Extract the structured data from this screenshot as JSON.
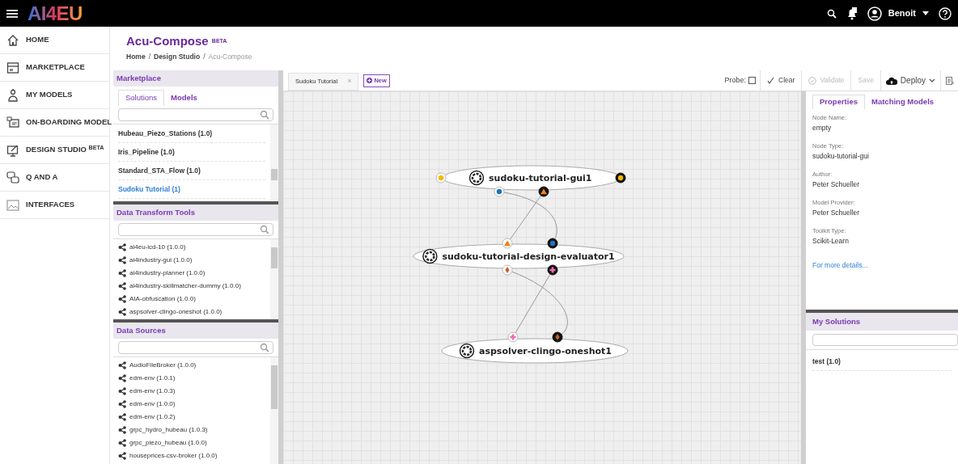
{
  "topbar": {
    "logo": "AI4EU",
    "user": "Benoit"
  },
  "sidebar": {
    "items": [
      {
        "label": "HOME"
      },
      {
        "label": "MARKETPLACE"
      },
      {
        "label": "MY MODELS"
      },
      {
        "label": "ON-BOARDING MODEL"
      },
      {
        "label": "DESIGN STUDIO $^{BETA}$"
      },
      {
        "label": "Q AND A"
      },
      {
        "label": "INTERFACES"
      }
    ]
  },
  "header": {
    "title": "Acu-Compose $^{BETA}$",
    "breadcrumb": [
      {
        "label": "Home",
        "current": false
      },
      {
        "label": "Design Studio",
        "current": false
      },
      {
        "label": "Acu-Compose",
        "current": true
      }
    ],
    "separator": "/"
  },
  "marketplace": {
    "title": "Marketplace",
    "tabs": [
      {
        "label": "Solutions",
        "selected": true
      },
      {
        "label": "Models",
        "selected": false
      }
    ],
    "items": [
      {
        "label": "Hubeau_Piezo_Stations (1.0)",
        "selected": false
      },
      {
        "label": "Iris_Pipeline (1.0)",
        "selected": false
      },
      {
        "label": "Standard_STA_Flow (1.0)",
        "selected": false
      },
      {
        "label": "Sudoku Tutorial (1)",
        "selected": true
      }
    ]
  },
  "data_transform_tools": {
    "title": "Data Transform Tools",
    "items": [
      "ai4eu-icd-10 (1.0.0)",
      "ai4industry-gui (1.0.0)",
      "ai4industry-planner (1.0.0)",
      "ai4industry-skillmatcher-dummy (1.0.0)",
      "AIA-obfuscation (1.0.0)",
      "aspsolver-clingo-oneshot (1.0.0)"
    ]
  },
  "data_sources": {
    "title": "Data Sources",
    "items": [
      "AudioFileBroker (1.0.0)",
      "edm-env (1.0.1)",
      "edm-env (1.0.3)",
      "edm-env (1.0.0)",
      "edm-env (1.0.2)",
      "grpc_hydro_hubeau (1.0.3)",
      "grpc_piezo_hubeau (1.0.0)",
      "houseprices-csv-broker (1.0.0)"
    ]
  },
  "toolbar": {
    "tab": "Sudoku Tutorial",
    "tab_close": "×",
    "new_button": "New",
    "probe_label": "Probe:",
    "probe_checked": false,
    "buttons": [
      {
        "label": "Clear",
        "disabled": false
      },
      {
        "label": "Validate",
        "disabled": true
      },
      {
        "label": "Save",
        "disabled": true
      },
      {
        "label": "Deploy",
        "disabled": false
      }
    ]
  },
  "canvas": {
    "nodes": [
      {
        "label": "sudoku-tutorial-gui1",
        "ports": [
          {
            "kind": "dot",
            "color": "#f5b800",
            "filled": false
          },
          {
            "kind": "dot",
            "color": "#f5b800",
            "filled": true
          },
          {
            "kind": "dot",
            "color": "#1e73be",
            "filled": false
          },
          {
            "kind": "triangle",
            "color": "#f07f1a",
            "filled": true
          }
        ]
      },
      {
        "label": "sudoku-tutorial-design-evaluator1",
        "ports": [
          {
            "kind": "triangle",
            "color": "#f07f1a",
            "filled": false
          },
          {
            "kind": "dot",
            "color": "#1e73be",
            "filled": true
          },
          {
            "kind": "diamond",
            "color": "#c0622a",
            "filled": false
          },
          {
            "kind": "plus",
            "color": "#f06ab4",
            "filled": true
          }
        ]
      },
      {
        "label": "aspsolver-clingo-oneshot1",
        "ports": [
          {
            "kind": "plus",
            "color": "#f06ab4",
            "filled": false
          },
          {
            "kind": "diamond",
            "color": "#c0622a",
            "filled": true
          }
        ]
      }
    ]
  },
  "properties": {
    "tabs": [
      {
        "label": "Properties",
        "selected": true
      },
      {
        "label": "Matching Models",
        "selected": false
      }
    ],
    "fields": [
      {
        "label": "Node Name:",
        "value": "empty"
      },
      {
        "label": "Node Type:",
        "value": "sudoku-tutorial-gui"
      },
      {
        "label": "Author:",
        "value": "Peter Schueller"
      },
      {
        "label": "Model Provider:",
        "value": "Peter Schueller"
      },
      {
        "label": "Toolkit Type:",
        "value": "Scikit-Learn"
      }
    ],
    "link": "For more details..."
  },
  "my_solutions": {
    "title": "My Solutions",
    "items": [
      "test (1.0)"
    ]
  }
}
